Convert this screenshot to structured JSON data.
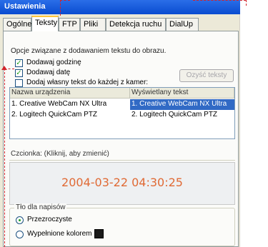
{
  "window": {
    "title": "Ustawienia"
  },
  "tabs": [
    {
      "label": "Ogólne"
    },
    {
      "label": "Teksty"
    },
    {
      "label": "FTP"
    },
    {
      "label": "Pliki"
    },
    {
      "label": "Detekcja ruchu"
    },
    {
      "label": "DialUp"
    }
  ],
  "options": {
    "intro": "Opcje związane z dodawaniem tekstu do obrazu.",
    "add_time": "Dodawaj godzinę",
    "add_date": "Dodawaj datę",
    "add_custom": "Dodaj własny tekst do każdej z kamer:",
    "clear_button": "Ozyść teksty"
  },
  "table": {
    "headers": [
      "Nazwa urządzenia",
      "Wyświetlany tekst"
    ],
    "rows": [
      {
        "device": "1. Creative WebCam NX Ultra",
        "text": "1. Creative WebCam NX Ultra"
      },
      {
        "device": "2. Logitech QuickCam PTZ",
        "text": "2. Logitech QuickCam PTZ"
      }
    ]
  },
  "font": {
    "label": "Czcionka: (Kliknij, aby zmienić)"
  },
  "preview": {
    "text": "2004-03-22 04:30:25",
    "color": "#e06a35"
  },
  "background": {
    "group_label": "Tło dla napisów",
    "transparent": "Przezroczyste",
    "filled": "Wypełnione kolorem",
    "fill_color": "#1a1a1a"
  },
  "colors": {
    "annotation": "#d2232a",
    "selection": "#316ac5"
  }
}
